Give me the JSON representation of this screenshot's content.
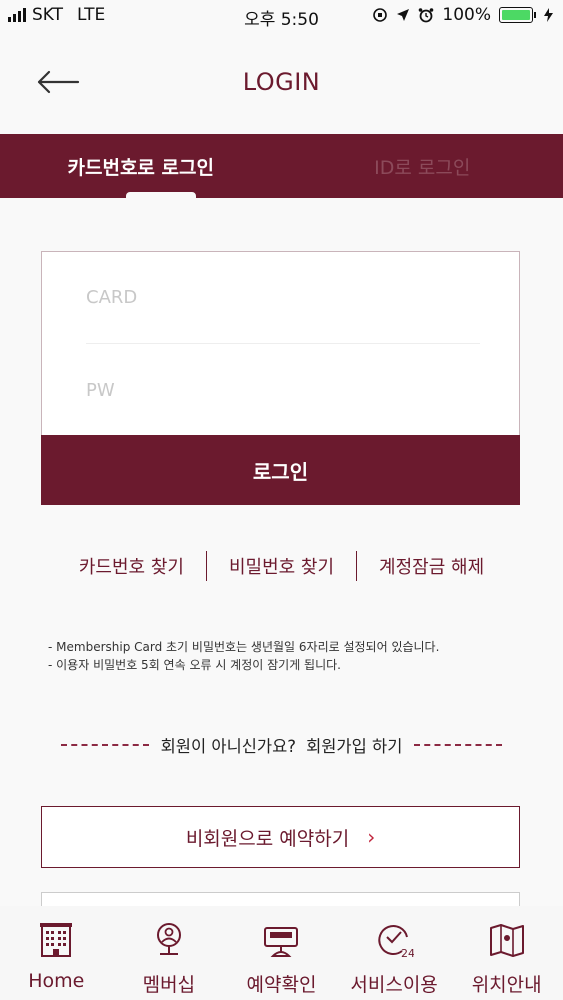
{
  "status_bar": {
    "carrier": "SKT",
    "network": "LTE",
    "time": "오후 5:50",
    "battery": "100%",
    "battery_level": 1.0
  },
  "nav": {
    "title": "LOGIN",
    "back_icon": "arrow-left-icon"
  },
  "tabs": [
    {
      "label": "카드번호로 로그인",
      "active": true
    },
    {
      "label": "ID로 로그인",
      "active": false
    }
  ],
  "form": {
    "card_placeholder": "CARD",
    "pw_placeholder": "PW",
    "login_label": "로그인"
  },
  "links": [
    "카드번호 찾기",
    "비밀번호 찾기",
    "계정잠금 해제"
  ],
  "notes": [
    "- Membership Card 초기 비밀번호는 생년월일 6자리로 설정되어 있습니다.",
    "- 이용자 비밀번호 5회 연속 오류 시 계정이 잠기게 됩니다."
  ],
  "signup": {
    "question": "회원이 아니신가요?",
    "link": "회원가입 하기"
  },
  "guest": {
    "label": "비회원으로 예약하기",
    "arrow": "›"
  },
  "bottom_nav": [
    {
      "label": "Home",
      "icon": "hotel-building-icon"
    },
    {
      "label": "멤버십",
      "icon": "member-medal-icon"
    },
    {
      "label": "예약확인",
      "icon": "reservation-bell-icon"
    },
    {
      "label": "서비스이용",
      "icon": "service-clock-icon"
    },
    {
      "label": "위치안내",
      "icon": "map-icon"
    }
  ],
  "colors": {
    "brand": "#6b1a2e",
    "accent_arrow": "#c0243c",
    "battery": "#4cd964"
  }
}
